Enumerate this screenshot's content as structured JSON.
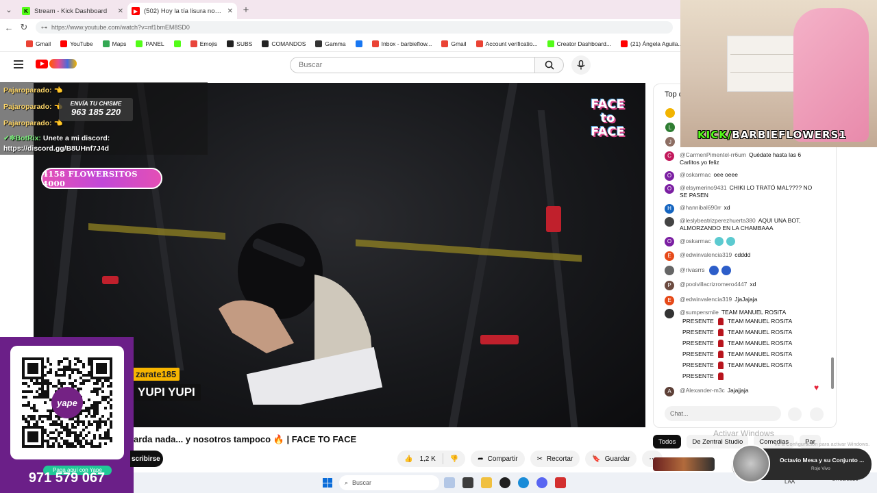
{
  "browser": {
    "tabs": [
      {
        "title": "Stream - Kick Dashboard",
        "favicon_color": "#53fc18",
        "active": false
      },
      {
        "title": "(502) Hoy la tía lisura no se guarda nada...",
        "favicon_color": "#ff0000",
        "active": true
      }
    ],
    "url": "https://www.youtube.com/watch?v=nf1bmEM8SD0",
    "bookmarks": [
      {
        "label": "Gmail",
        "color": "#ea4335"
      },
      {
        "label": "YouTube",
        "color": "#ff0000"
      },
      {
        "label": "Maps",
        "color": "#34a853"
      },
      {
        "label": "PANEL",
        "color": "#53fc18"
      },
      {
        "label": "",
        "color": "#53fc18"
      },
      {
        "label": "Emojis",
        "color": "#e8453c"
      },
      {
        "label": "SUBS",
        "color": "#222222"
      },
      {
        "label": "COMANDOS",
        "color": "#222222"
      },
      {
        "label": "Gamma",
        "color": "#333333"
      },
      {
        "label": "",
        "color": "#1877f2"
      },
      {
        "label": "Inbox - barbieflow...",
        "color": "#ea4335"
      },
      {
        "label": "Gmail",
        "color": "#ea4335"
      },
      {
        "label": "Account verificatio...",
        "color": "#ea4335"
      },
      {
        "label": "Creator Dashboard...",
        "color": "#53fc18"
      },
      {
        "label": "(21) Ángela Aguila...",
        "color": "#ff0000"
      }
    ]
  },
  "youtube": {
    "search_placeholder": "Buscar",
    "video_title": "arda nada... y nosotros tampoco 🔥 | FACE TO FACE",
    "subscribe_label": "scribirse",
    "likes": "1,2 K",
    "share_label": "Compartir",
    "clip_label": "Recortar",
    "save_label": "Guardar",
    "more_label": "⋯",
    "face_badge": "FACE to FACE",
    "subtitle_user": "zarate185",
    "subtitle_msg": "YUPI YUPI"
  },
  "overlay": {
    "chat": [
      {
        "user": "Pajaroparado:",
        "msg": "👈"
      },
      {
        "user": "Pajaroparado:",
        "msg": "👈"
      },
      {
        "user": "Pajaroparado:",
        "msg": "👈"
      }
    ],
    "bot_user": "✔✽BotRix:",
    "bot_msg_1": "Unete a mi discord:",
    "bot_msg_2": "https://discord.gg/B8UHnf7J4d",
    "chisme_title": "ENVÍA TU CHISME",
    "chisme_number": "963 185 220",
    "flowersitos": "4158 FLOWERSITOS 4000",
    "yape_label": "Paga aquí con Yape",
    "yape_number": "971 579 067",
    "yape_logo": "yape"
  },
  "livechat": {
    "header": "Top c",
    "messages": [
      {
        "initial": "C",
        "color": "#c2185b",
        "name": "@CarmenPimentel-rr6um",
        "text": "Quédate hasta las 6 Carlitos yo feliz",
        "emoji": ""
      },
      {
        "initial": "O",
        "color": "#7b1fa2",
        "name": "@oskarmac",
        "text": "oee oeee",
        "emoji": ""
      },
      {
        "initial": "O",
        "color": "#7b1fa2",
        "name": "@elsymerino9431",
        "text": "CHIKI LO TRATÓ MAL???? NO SE PASEN",
        "emoji": ""
      },
      {
        "initial": "H",
        "color": "#1565c0",
        "name": "@hannibal690rr",
        "text": "xd",
        "emoji": ""
      },
      {
        "initial": "",
        "color": "#444444",
        "name": "@leslybeatrizperezhuerta380",
        "text": "AQUI UNA BOT, ALMORZANDO EN LA CHAMBAAA",
        "emoji": ""
      },
      {
        "initial": "O",
        "color": "#7b1fa2",
        "name": "@oskarmac",
        "text": "",
        "emoji": "blob"
      },
      {
        "initial": "E",
        "color": "#e64a19",
        "name": "@edwinvalencia319",
        "text": "cdddd",
        "emoji": ""
      },
      {
        "initial": "",
        "color": "#666666",
        "name": "@rivasrrs",
        "text": "",
        "emoji": "blue"
      },
      {
        "initial": "P",
        "color": "#6d4c41",
        "name": "@poolvillacrizromero4447",
        "text": "xd",
        "emoji": ""
      },
      {
        "initial": "E",
        "color": "#e64a19",
        "name": "@edwinvalencia319",
        "text": "JjaJajaja",
        "emoji": ""
      },
      {
        "initial": "",
        "color": "#333333",
        "name": "@sumpersmile",
        "text": "TEAM MANUEL ROSITA",
        "emoji": ""
      },
      {
        "initial": "A",
        "color": "#5d4037",
        "name": "@Alexander-m3c",
        "text": "Jajajjaja",
        "emoji": ""
      }
    ],
    "presente_lines": [
      {
        "left": "PRESENTE",
        "right": "TEAM MANUEL ROSITA"
      },
      {
        "left": "PRESENTE",
        "right": "TEAM MANUEL ROSITA"
      },
      {
        "left": "PRESENTE",
        "right": "TEAM MANUEL ROSITA"
      },
      {
        "left": "PRESENTE",
        "right": "TEAM MANUEL ROSITA"
      },
      {
        "left": "PRESENTE",
        "right": "TEAM MANUEL ROSITA"
      },
      {
        "left": "PRESENTE",
        "right": ""
      }
    ],
    "side_avatars": [
      {
        "initial": "",
        "color": "#f2b400"
      },
      {
        "initial": "L",
        "color": "#2e7d32"
      },
      {
        "initial": "J",
        "color": "#8d6e63"
      }
    ],
    "input_placeholder": "Chat...",
    "heart": "♥"
  },
  "chips": [
    {
      "label": "Todos",
      "active": true
    },
    {
      "label": "De Zentral Studio",
      "active": false
    },
    {
      "label": "Comedias",
      "active": false
    },
    {
      "label": "Par",
      "active": false
    }
  ],
  "windows_watermark": {
    "line1": "Activar Windows",
    "line2": "Ve a Configuración para activar Windows."
  },
  "webcam": {
    "brand_k": "KICK/",
    "brand_rest": "BARBIEFLOWERS1"
  },
  "taskbar": {
    "search_placeholder": "Buscar",
    "tray_lang": "LAA",
    "time": "",
    "date": "27/02/2026"
  },
  "media": {
    "title": "Octavio Mesa y su Conjunto ...",
    "subtitle": "Rojo Vivo"
  }
}
